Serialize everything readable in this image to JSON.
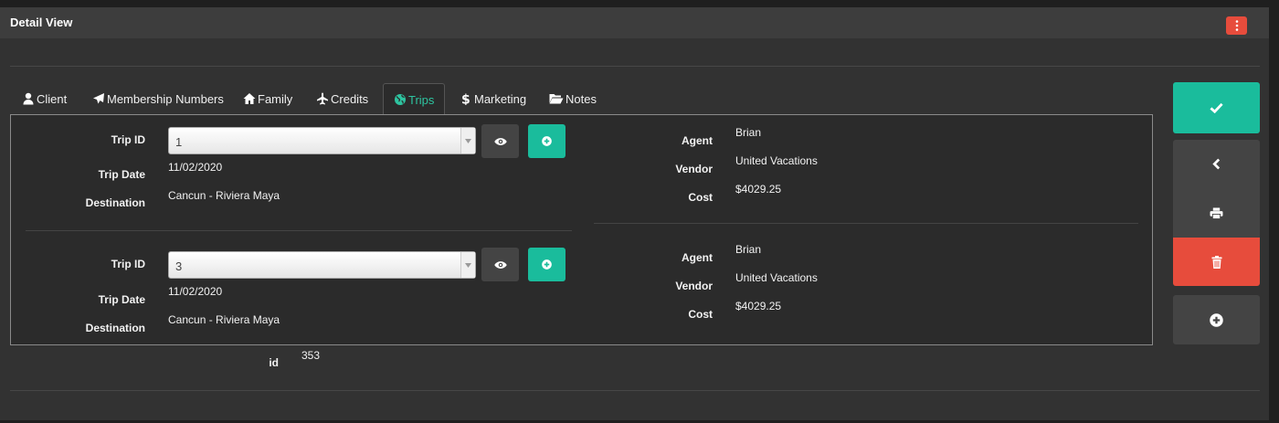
{
  "header": {
    "title": "Detail View",
    "menu_icon": "kebab-vertical-icon"
  },
  "tabs": [
    {
      "label": "Client",
      "icon": "user-icon"
    },
    {
      "label": "Membership Numbers",
      "icon": "plane-icon"
    },
    {
      "label": "Family",
      "icon": "home-icon"
    },
    {
      "label": "Credits",
      "icon": "plane-up-icon"
    },
    {
      "label": "Trips",
      "icon": "globe-icon",
      "active": true
    },
    {
      "label": "Marketing",
      "icon": "dollar-icon"
    },
    {
      "label": "Notes",
      "icon": "folder-open-icon"
    }
  ],
  "labels": {
    "trip_id": "Trip ID",
    "trip_date": "Trip Date",
    "destination": "Destination",
    "agent": "Agent",
    "vendor": "Vendor",
    "cost": "Cost"
  },
  "trips": [
    {
      "trip_id": "1",
      "trip_date": "11/02/2020",
      "destination": "Cancun - Riviera Maya",
      "agent": "Brian",
      "vendor": "United Vacations",
      "cost": "$4029.25"
    },
    {
      "trip_id": "3",
      "trip_date": "11/02/2020",
      "destination": "Cancun - Riviera Maya",
      "agent": "Brian",
      "vendor": "United Vacations",
      "cost": "$4029.25"
    }
  ],
  "record": {
    "id_label": "id",
    "id_value": "353"
  },
  "colors": {
    "accent": "#1abc9c",
    "danger": "#e74c3c",
    "background": "#323232",
    "button_gray": "#444444"
  },
  "side_actions": [
    {
      "icon": "check-icon",
      "action": "save"
    },
    {
      "icon": "chevron-left-icon",
      "action": "back"
    },
    {
      "icon": "print-icon",
      "action": "print"
    },
    {
      "icon": "trash-icon",
      "action": "delete"
    },
    {
      "icon": "plus-circle-icon",
      "action": "add"
    }
  ]
}
